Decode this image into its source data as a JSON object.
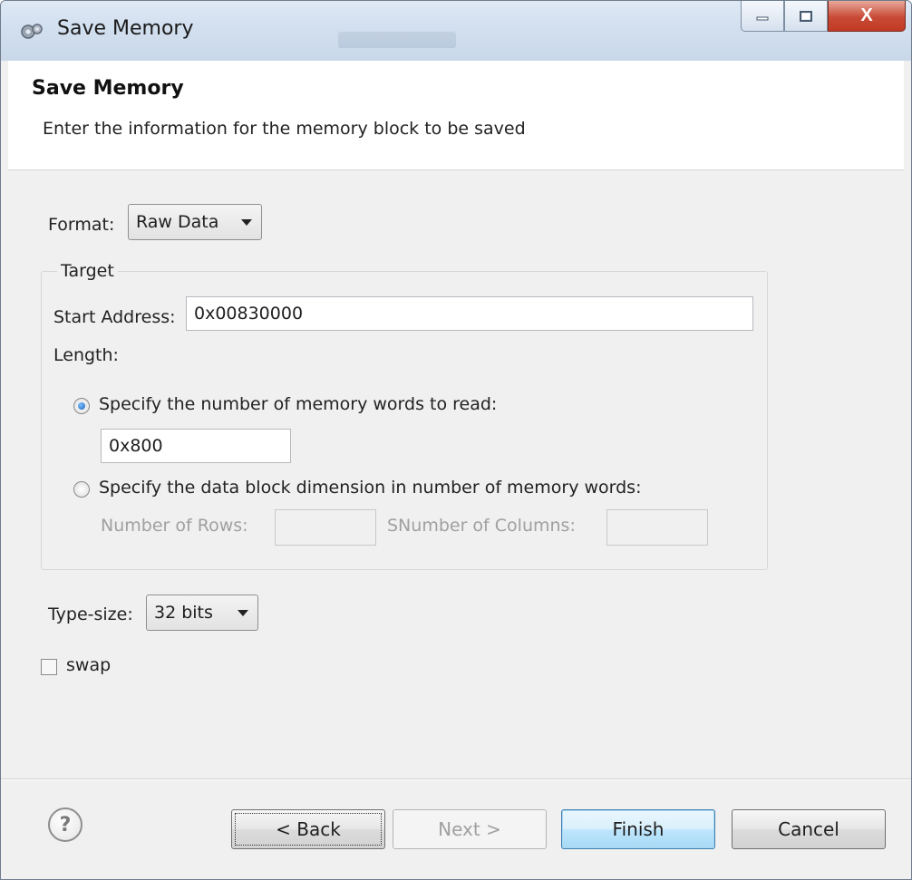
{
  "window": {
    "title": "Save Memory",
    "close_glyph": "X"
  },
  "banner": {
    "heading": "Save Memory",
    "description": "Enter the information for the memory block to be saved"
  },
  "format": {
    "label": "Format:",
    "value": "Raw Data"
  },
  "target": {
    "group_title": "Target",
    "start_address_label": "Start Address:",
    "start_address_value": "0x00830000",
    "length_label": "Length:",
    "option_words_label": "Specify the number of memory words to read:",
    "option_words_selected": true,
    "words_value": "0x800",
    "option_block_label": "Specify the data block dimension in number of memory words:",
    "option_block_selected": false,
    "rows_label": "Number of Rows:",
    "rows_value": "",
    "columns_label": "SNumber of Columns:",
    "columns_value": ""
  },
  "type_size": {
    "label": "Type-size:",
    "value": "32 bits"
  },
  "swap": {
    "label": "swap",
    "checked": false
  },
  "footer": {
    "help_glyph": "?",
    "back_label": "< Back",
    "next_label": "Next >",
    "finish_label": "Finish",
    "cancel_label": "Cancel"
  },
  "colors": {
    "titlebar": "#d3e0ef",
    "dialog_bg": "#f0f0f0",
    "close_button": "#c74a36",
    "default_button": "#3c7fb1"
  }
}
